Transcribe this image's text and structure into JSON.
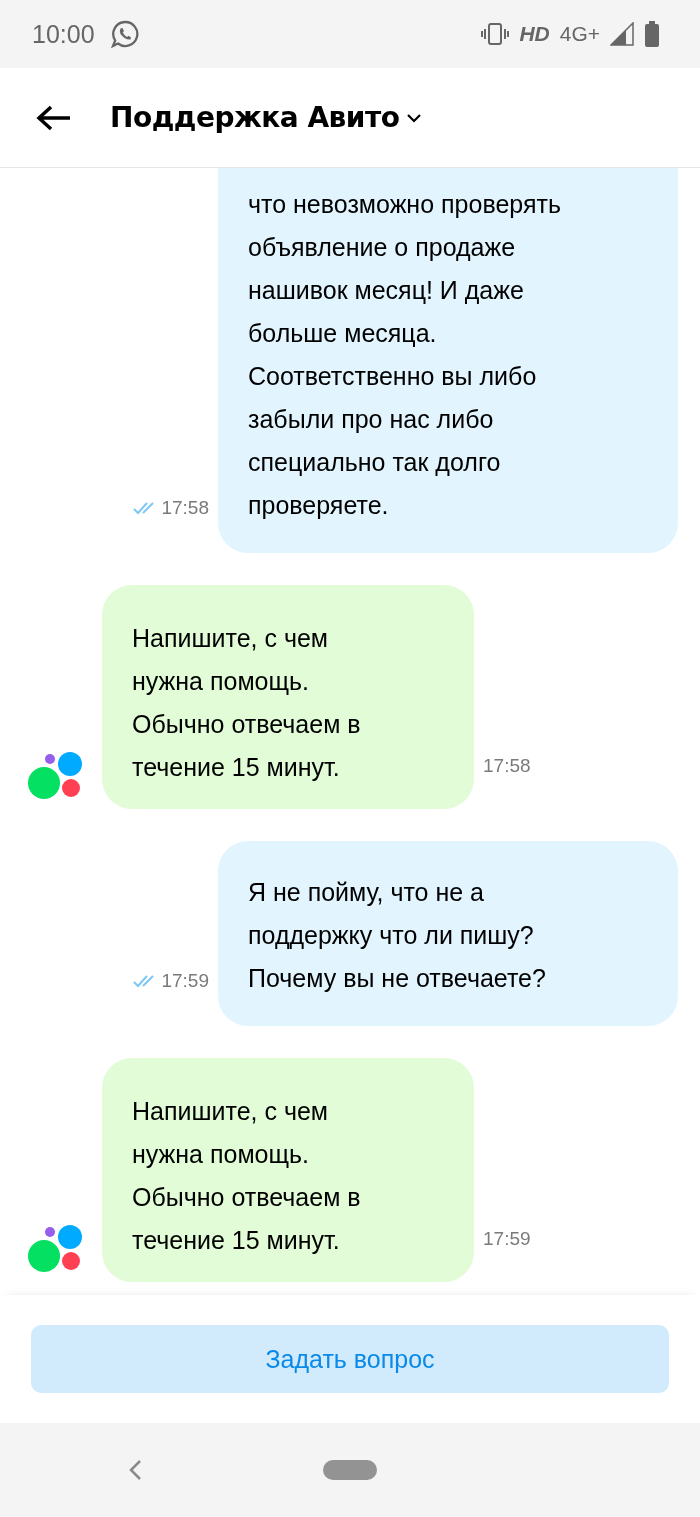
{
  "status_bar": {
    "time": "10:00",
    "network_hd": "HD",
    "network_type": "4G+"
  },
  "header": {
    "title": "Поддержка Авито"
  },
  "messages": [
    {
      "kind": "outgoing",
      "text": "что невозможно проверять\nобъявление о продаже\nнашивок месяц! И даже\nбольше месяца.\nСоответственно вы либо\nзабыли про нас либо\nспециально так долго\nпроверяете.",
      "time": "17:58",
      "read": true
    },
    {
      "kind": "incoming",
      "text": "Напишите, с чем\nнужна помощь.\nОбычно отвечаем в\nтечение 15 минут.",
      "time": "17:58"
    },
    {
      "kind": "outgoing",
      "text": "Я не пойму, что не а\nподдержку что ли пишу?\nПочему вы не отвечаете?",
      "time": "17:59",
      "read": true
    },
    {
      "kind": "incoming",
      "text": "Напишите, с чем\nнужна помощь.\nОбычно отвечаем в\nтечение 15 минут.",
      "time": "17:59"
    }
  ],
  "action_button": {
    "label": "Задать вопрос"
  }
}
